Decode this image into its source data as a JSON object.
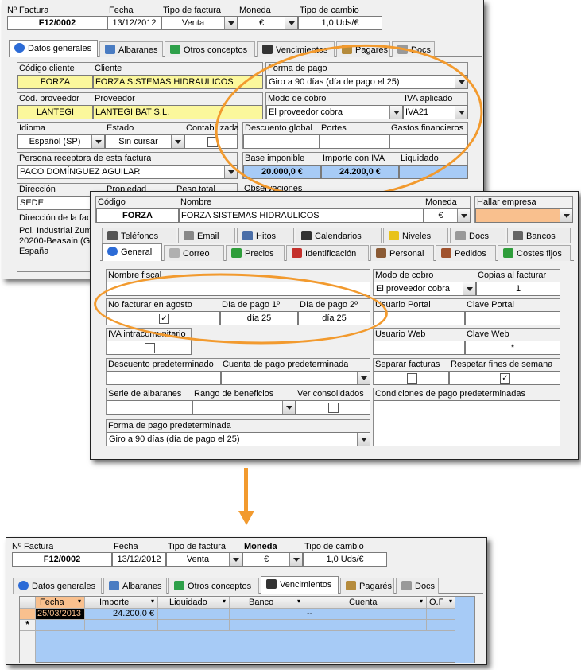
{
  "top": {
    "factura_label": "Nº Factura",
    "factura_value": "F12/0002",
    "fecha_label": "Fecha",
    "fecha_value": "13/12/2012",
    "tipo_label": "Tipo de factura",
    "tipo_value": "Venta",
    "moneda_label": "Moneda",
    "moneda_value": "€",
    "cambio_label": "Tipo de cambio",
    "cambio_value": "1,0 Uds/€",
    "tabs": [
      "Datos generales",
      "Albaranes",
      "Otros conceptos",
      "Vencimientos",
      "Pagarés",
      "Docs"
    ],
    "codigo_cliente_label": "Código cliente",
    "codigo_cliente_value": "FORZA",
    "cliente_label": "Cliente",
    "cliente_value": "FORZA SISTEMAS HIDRAULICOS",
    "forma_pago_label": "Forma de pago",
    "forma_pago_value": "Giro a 90 días (día de pago el 25)",
    "cod_proveedor_label": "Cód. proveedor",
    "cod_proveedor_value": "LANTEGI",
    "proveedor_label": "Proveedor",
    "proveedor_value": "LANTEGI BAT S.L.",
    "modo_cobro_label": "Modo de cobro",
    "modo_cobro_value": "El proveedor cobra",
    "iva_label": "IVA aplicado",
    "iva_value": "IVA21",
    "idioma_label": "Idioma",
    "idioma_value": "Español (SP)",
    "estado_label": "Estado",
    "estado_value": "Sin cursar",
    "contabilizada_label": "Contabilizada",
    "descuento_label": "Descuento global",
    "portes_label": "Portes",
    "gastos_label": "Gastos financieros",
    "persona_label": "Persona receptora de esta factura",
    "persona_value": "PACO DOMÍNGUEZ AGUILAR",
    "base_label": "Base imponible",
    "base_value": "20.000,0 €",
    "importe_label": "Importe con IVA",
    "importe_value": "24.200,0 €",
    "liquidado_label": "Liquidado",
    "direccion_label": "Dirección",
    "direccion_value": "SEDE",
    "propiedad_label": "Propiedad",
    "peso_label": "Peso total",
    "observaciones_label": "Observaciones",
    "direccion_fact_label": "Dirección de la fact",
    "addr1": "Pol. Industrial Zum",
    "addr2": "20200-Beasain (GI",
    "addr3": "España"
  },
  "client": {
    "codigo_label": "Código",
    "codigo_value": "FORZA",
    "nombre_label": "Nombre",
    "nombre_value": "FORZA SISTEMAS HIDRAULICOS",
    "moneda_label": "Moneda",
    "moneda_value": "€",
    "hallar_label": "Hallar empresa",
    "tabs_row1": [
      "Teléfonos",
      "Email",
      "Hitos",
      "Calendarios",
      "Niveles",
      "Docs",
      "Bancos"
    ],
    "tabs_row2": [
      "General",
      "Correo",
      "Precios",
      "Identificación",
      "Personal",
      "Pedidos",
      "Costes fijos"
    ],
    "nombre_fiscal_label": "Nombre fiscal",
    "modo_cobro_label": "Modo de cobro",
    "modo_cobro_value": "El proveedor cobra",
    "copias_label": "Copias al facturar",
    "copias_value": "1",
    "no_facturar_label": "No facturar en agosto",
    "no_facturar_check": "✓",
    "dia1_label": "Día de pago 1º",
    "dia1_value": "día 25",
    "dia2_label": "Día de pago 2º",
    "dia2_value": "día 25",
    "usuario_portal_label": "Usuario Portal",
    "clave_portal_label": "Clave Portal",
    "iva_intra_label": "IVA intracomunitario",
    "usuario_web_label": "Usuario Web",
    "clave_web_label": "Clave Web",
    "clave_web_value": "*",
    "descuento_label": "Descuento predeterminado",
    "cuenta_label": "Cuenta de pago predeterminada",
    "separar_label": "Separar facturas",
    "respetar_label": "Respetar fines de semana",
    "respetar_check": "✓",
    "serie_label": "Serie de albaranes",
    "rango_label": "Rango de beneficios",
    "ver_label": "Ver consolidados",
    "condiciones_label": "Condiciones de pago predeterminadas",
    "forma_pago_label": "Forma de pago predeterminada",
    "forma_pago_value": "Giro a 90 días (día de pago el 25)"
  },
  "bottom": {
    "factura_label": "Nº Factura",
    "factura_value": "F12/0002",
    "fecha_label": "Fecha",
    "fecha_value": "13/12/2012",
    "tipo_label": "Tipo de factura",
    "tipo_value": "Venta",
    "moneda_label": "Moneda",
    "moneda_value": "€",
    "cambio_label": "Tipo de cambio",
    "cambio_value": "1,0 Uds/€",
    "tabs": [
      "Datos generales",
      "Albaranes",
      "Otros conceptos",
      "Vencimientos",
      "Pagarés",
      "Docs"
    ],
    "grid_headers": [
      "Fecha",
      "Importe",
      "Liquidado",
      "Banco",
      "Cuenta",
      "O.F"
    ],
    "row": {
      "fecha": "25/03/2013",
      "importe": "24.200,0 €",
      "cuenta": "--"
    },
    "new_row_marker": "*"
  },
  "colors": {
    "yellow": "#fbf79c",
    "blue": "#a7cbf6",
    "orange": "#f29a2e",
    "salmon": "#f9c08e"
  }
}
